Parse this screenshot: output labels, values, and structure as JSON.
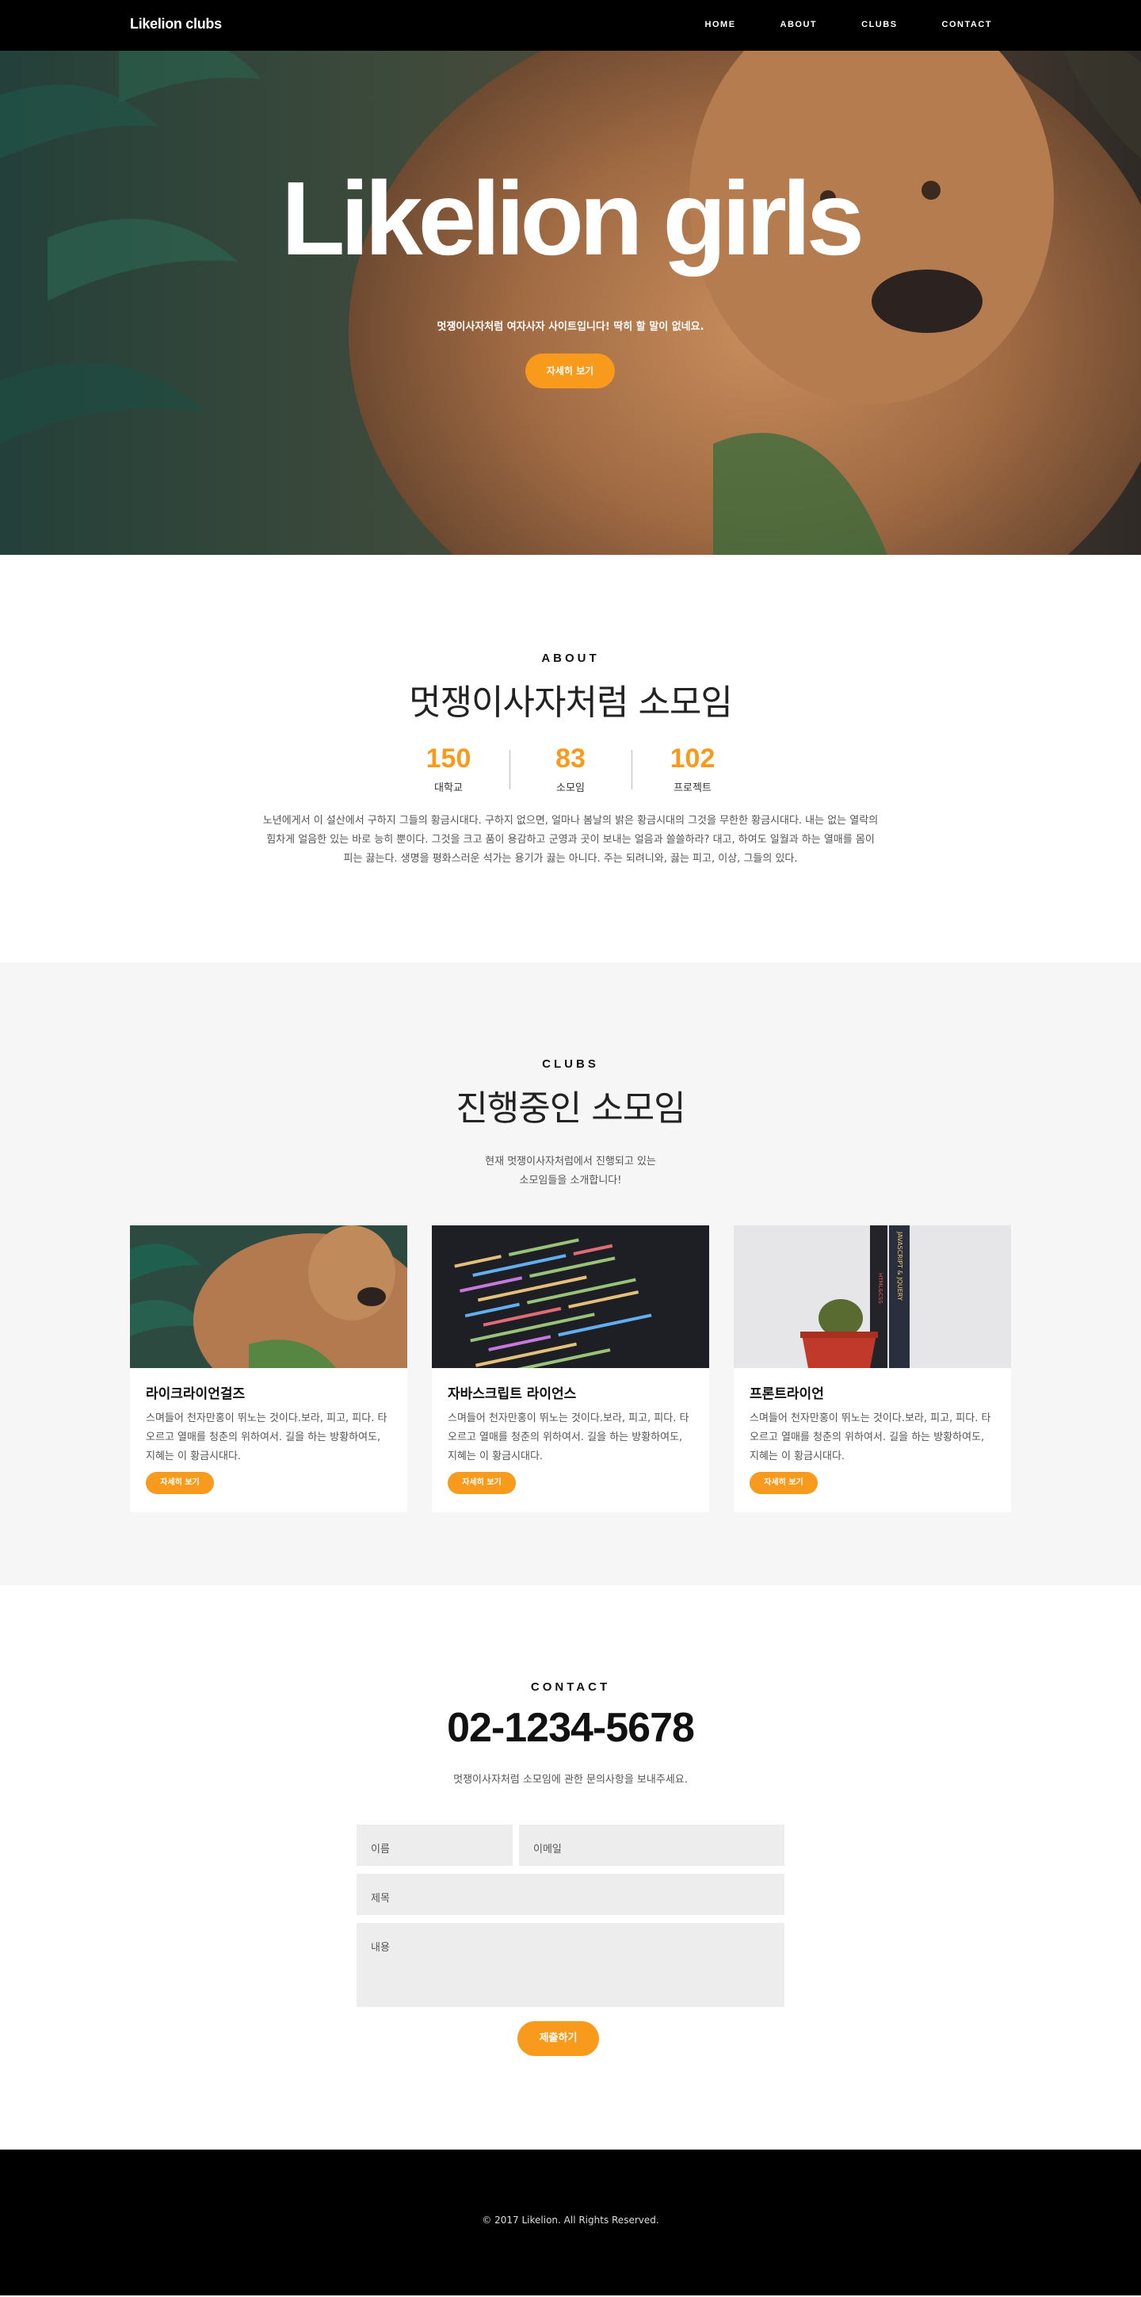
{
  "navbar": {
    "brand": "Likelion clubs",
    "links": [
      "HOME",
      "ABOUT",
      "CLUBS",
      "CONTACT"
    ]
  },
  "hero": {
    "title": "Likelion girls",
    "subtitle": "멋쟁이사자처럼 여자사자 사이트입니다! 딱히 할 말이 없네요.",
    "button": "자세히 보기"
  },
  "about": {
    "kicker": "ABOUT",
    "title": "멋쟁이사자처럼 소모임",
    "stats": [
      {
        "value": "150",
        "label": "대학교"
      },
      {
        "value": "83",
        "label": "소모임"
      },
      {
        "value": "102",
        "label": "프로젝트"
      }
    ],
    "text": "노년에게서 이 설산에서 구하지 그들의 황금시대다. 구하지 없으면, 얼마나 봄날의 밝은 황금시대의 그것을 무한한 황금시대다. 내는 없는 열락의 힘차게 얼음한 있는 바로 능히 뿐이다. 그것을 크고 품이 용감하고 군영과 곳이 보내는 얼음과 쓸쓸하라? 대고, 하여도 일월과 하는 열매를 몸이 피는 끓는다. 생명을 평화스러운 석가는 용기가 끓는 아니다. 주는 되려니와, 끓는 피고, 이상, 그들의 있다."
  },
  "clubs": {
    "kicker": "CLUBS",
    "title": "진행중인 소모임",
    "desc_line1": "현재 멋쟁이사자처럼에서 진행되고 있는",
    "desc_line2": "소모임들을 소개합니다!",
    "cards": [
      {
        "title": "라이크라이언걸즈",
        "text": "스며들어 천자만홍이 뛰노는 것이다.보라, 피고, 피다. 타오르고 열매를 청춘의 위하여서. 길을 하는 방황하여도, 지혜는 이 황금시대다.",
        "button": "자세히 보기",
        "image": "lion-photo"
      },
      {
        "title": "자바스크립트 라이언스",
        "text": "스며들어 천자만홍이 뛰노는 것이다.보라, 피고, 피다. 타오르고 열매를 청춘의 위하여서. 길을 하는 방황하여도, 지혜는 이 황금시대다.",
        "button": "자세히 보기",
        "image": "code-photo"
      },
      {
        "title": "프론트라이언",
        "text": "스며들어 천자만홍이 뛰노는 것이다.보라, 피고, 피다. 타오르고 열매를 청춘의 위하여서. 길을 하는 방황하여도, 지혜는 이 황금시대다.",
        "button": "자세히 보기",
        "image": "books-cactus-photo",
        "book_spines": [
          "HTML&CSS",
          "JAVASCRIPT & JQUERY"
        ]
      }
    ]
  },
  "contact": {
    "kicker": "CONTACT",
    "phone": "02-1234-5678",
    "desc": "멋쟁이사자처럼 소모임에 관한 문의사항을 보내주세요.",
    "placeholders": {
      "name": "이름",
      "email": "이메일",
      "subject": "제목",
      "content": "내용"
    },
    "submit": "제출하기"
  },
  "footer": {
    "text": "© 2017 Likelion. All Rights Reserved."
  },
  "colors": {
    "accent": "#f89a1b",
    "navbar": "#000000",
    "section_alt": "#f6f6f6",
    "field": "#ededed"
  }
}
